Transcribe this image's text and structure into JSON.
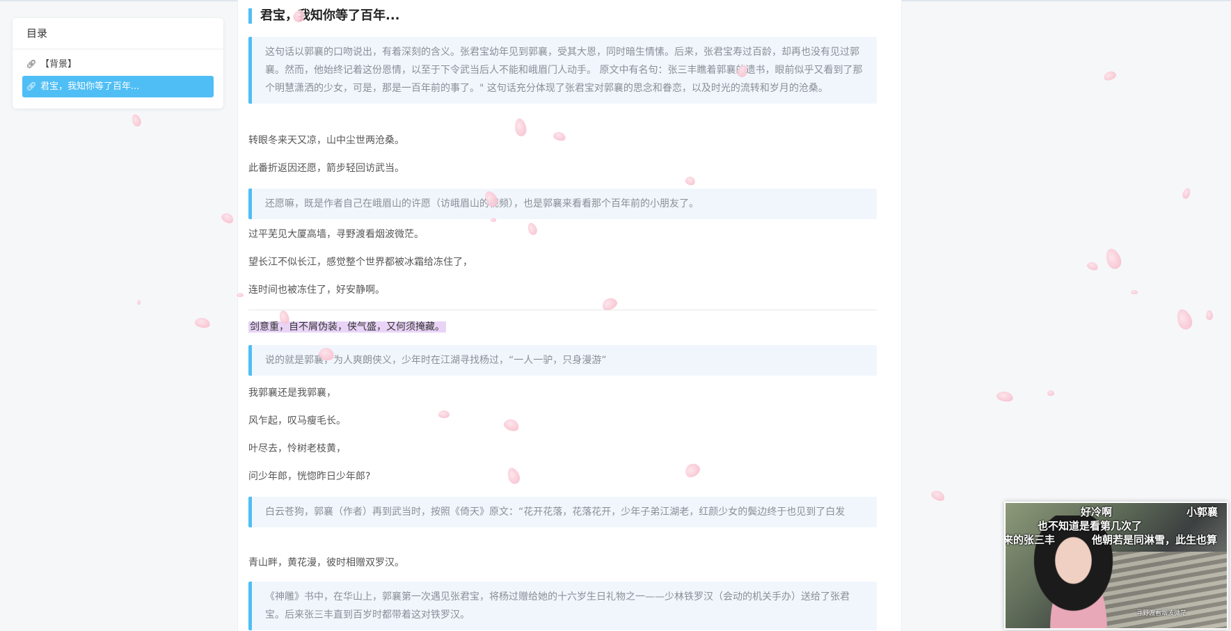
{
  "toc": {
    "title": "目录",
    "items": [
      {
        "label": "【背景】",
        "active": false
      },
      {
        "label": "君宝，我知你等了百年...",
        "active": true
      }
    ]
  },
  "article": {
    "heading": "君宝，我知你等了百年...",
    "blocks": [
      {
        "type": "quote",
        "text": "这句话以郭襄的口吻说出，有着深刻的含义。张君宝幼年见到郭襄，受其大恩，同时暗生情愫。后来，张君宝寿过百龄，却再也没有见过郭襄。然而，他始终记着这份恩情，以至于下令武当后人不能和峨眉门人动手。 原文中有名句：张三丰瞧着郭襄的遗书，眼前似乎又看到了那个明慧潇洒的少女，可是，那是一百年前的事了。\" 这句话充分体现了张君宝对郭襄的思念和眷恋，以及时光的流转和岁月的沧桑。"
      },
      {
        "type": "p",
        "text": "转眼冬来天又凉，山中尘世两沧桑。"
      },
      {
        "type": "p",
        "text": "此番折返因还愿，箭步轻回访武当。"
      },
      {
        "type": "quote",
        "text": "还愿嘛，既是作者自己在峨眉山的许愿（访峨眉山的视频），也是郭襄来看看那个百年前的小朋友了。"
      },
      {
        "type": "p",
        "text": "过平芜见大厦高墙，寻野渡看烟波微茫。"
      },
      {
        "type": "p",
        "text": "望长江不似长江，感觉整个世界都被冰霜给冻住了，"
      },
      {
        "type": "p",
        "text": "连时间也被冻住了，好安静啊。"
      },
      {
        "type": "highlight",
        "text": "剑意重，自不屑伪装，侠气盛，又何须掩藏。"
      },
      {
        "type": "quote",
        "text": "说的就是郭襄，为人爽朗侠义，少年时在江湖寻找杨过，“一人一驴，只身漫游”"
      },
      {
        "type": "p",
        "text": "我郭襄还是我郭襄，"
      },
      {
        "type": "p",
        "text": "风乍起，叹马瘦毛长。"
      },
      {
        "type": "p",
        "text": "叶尽去，怜树老枝黄，"
      },
      {
        "type": "p",
        "text": "问少年郎，恍惚昨日少年郎?"
      },
      {
        "type": "quote",
        "text": "白云苍狗，郭襄（作者）再到武当时，按照《倚天》原文：“花开花落，花落花开，少年子弟江湖老，红颜少女的鬓边终于也见到了白发"
      },
      {
        "type": "p",
        "text": "青山畔，黄花漫，彼时相赠双罗汉。"
      },
      {
        "type": "quote",
        "text": "《神雕》书中，在华山上，郭襄第一次遇见张君宝，将杨过赠给她的十六岁生日礼物之一——少林铁罗汉（会动的机关手办）送给了张君宝。后来张三丰直到百岁时都带着这对铁罗汉。"
      }
    ]
  },
  "video": {
    "danmaku": [
      "好冷啊",
      "小郭襄",
      "也不知道是看第几次了",
      "来的张三丰",
      "他朝若是同淋雪，此生也算"
    ],
    "caption": "寻野渡看烟波微茫"
  },
  "colors": {
    "accent": "#4fbef5",
    "quote_bg": "#f1f6fd",
    "highlight": "#e9d4f7",
    "petal": "#f6b5c6"
  }
}
